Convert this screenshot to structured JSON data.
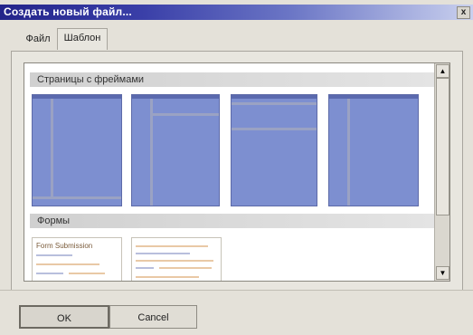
{
  "window": {
    "title": "Создать новый файл...",
    "close_glyph": "x"
  },
  "tabs": [
    {
      "label": "Файл"
    },
    {
      "label": "Шаблон"
    }
  ],
  "sections": {
    "frames": {
      "title": "Страницы с фреймами"
    },
    "forms": {
      "title": "Формы",
      "form1_label": "Form Submission"
    }
  },
  "scrollbar": {
    "up": "▲",
    "down": "▼"
  },
  "buttons": {
    "ok": "OK",
    "cancel": "Cancel"
  },
  "colors": {
    "title_gradient_start": "#23248a",
    "thumbnail_fill": "#7d8fd0"
  }
}
